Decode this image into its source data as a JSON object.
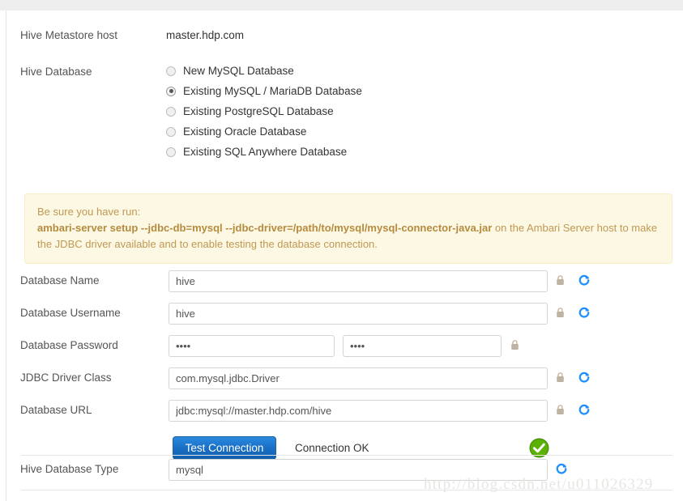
{
  "form": {
    "metastore_host": {
      "label": "Hive Metastore host",
      "value": "master.hdp.com"
    },
    "hive_database": {
      "label": "Hive Database",
      "options": [
        {
          "label": "New MySQL Database",
          "selected": false
        },
        {
          "label": "Existing MySQL / MariaDB Database",
          "selected": true
        },
        {
          "label": "Existing PostgreSQL Database",
          "selected": false
        },
        {
          "label": "Existing Oracle Database",
          "selected": false
        },
        {
          "label": "Existing SQL Anywhere Database",
          "selected": false
        }
      ]
    },
    "alert": {
      "intro": "Be sure you have run:",
      "command": "ambari-server setup --jdbc-db=mysql --jdbc-driver=/path/to/mysql/mysql-connector-java.jar",
      "suffix": " on the Ambari Server host to make the JDBC driver available and to enable testing the database connection."
    },
    "fields": [
      {
        "label": "Database Name",
        "value": "hive"
      },
      {
        "label": "Database Username",
        "value": "hive"
      },
      {
        "label": "Database Password",
        "value": "••••",
        "value_confirm": "••••"
      },
      {
        "label": "JDBC Driver Class",
        "value": "com.mysql.jdbc.Driver"
      },
      {
        "label": "Database URL",
        "value": "jdbc:mysql://master.hdp.com/hive"
      },
      {
        "label": "Hive Database Type",
        "value": "mysql"
      }
    ],
    "test_connection": {
      "button_label": "Test Connection",
      "status_text": "Connection OK",
      "status_icon": "check-circle-icon"
    }
  },
  "icons": {
    "lock": "lock-icon",
    "refresh": "refresh-icon"
  },
  "colors": {
    "accent_blue": "#1a6fc4",
    "success_green": "#5bb204",
    "alert_bg": "#fcf8e3",
    "alert_text": "#c09853"
  },
  "watermark": {
    "text": "http://blog.csdn.net/u011026329"
  }
}
